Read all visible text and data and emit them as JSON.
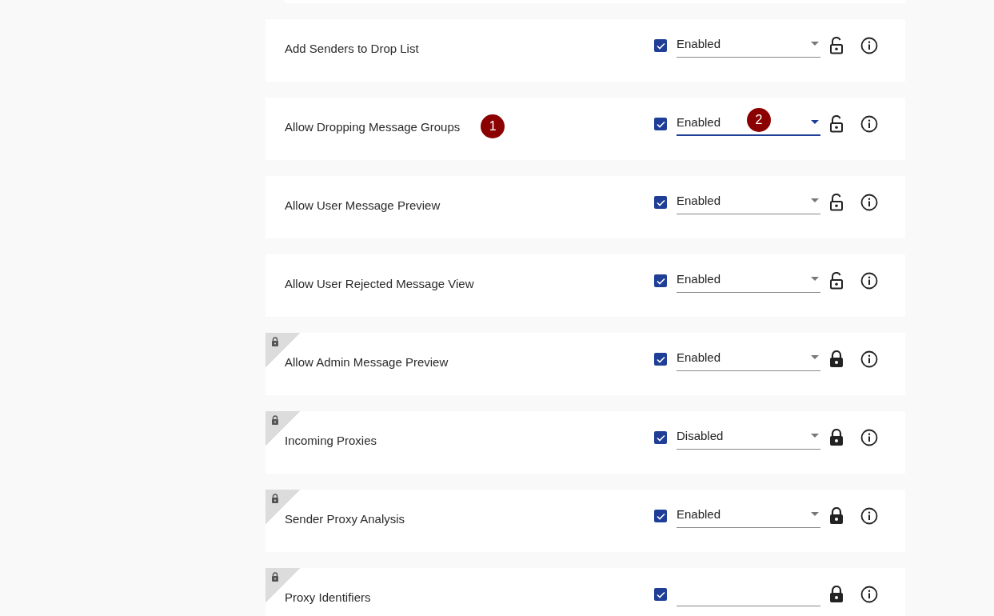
{
  "settings": [
    {
      "label": "Add Senders to Drop List",
      "checked": true,
      "kind": "select",
      "value": "Enabled",
      "focused": false,
      "locked": false
    },
    {
      "label": "Allow Dropping Message Groups",
      "label_marker": "1",
      "checked": true,
      "kind": "select",
      "value": "Enabled",
      "value_marker": "2",
      "focused": true,
      "locked": false
    },
    {
      "label": "Allow User Message Preview",
      "checked": true,
      "kind": "select",
      "value": "Enabled",
      "focused": false,
      "locked": false
    },
    {
      "label": "Allow User Rejected Message View",
      "checked": true,
      "kind": "select",
      "value": "Enabled",
      "focused": false,
      "locked": false
    },
    {
      "label": "Allow Admin Message Preview",
      "checked": true,
      "kind": "select",
      "value": "Enabled",
      "focused": false,
      "locked": true
    },
    {
      "label": "Incoming Proxies",
      "checked": true,
      "kind": "select",
      "value": "Disabled",
      "focused": false,
      "locked": true
    },
    {
      "label": "Sender Proxy Analysis",
      "checked": true,
      "kind": "select",
      "value": "Enabled",
      "focused": false,
      "locked": true
    },
    {
      "label": "Proxy Identifiers",
      "checked": true,
      "kind": "text",
      "focused": false,
      "locked": true
    }
  ]
}
